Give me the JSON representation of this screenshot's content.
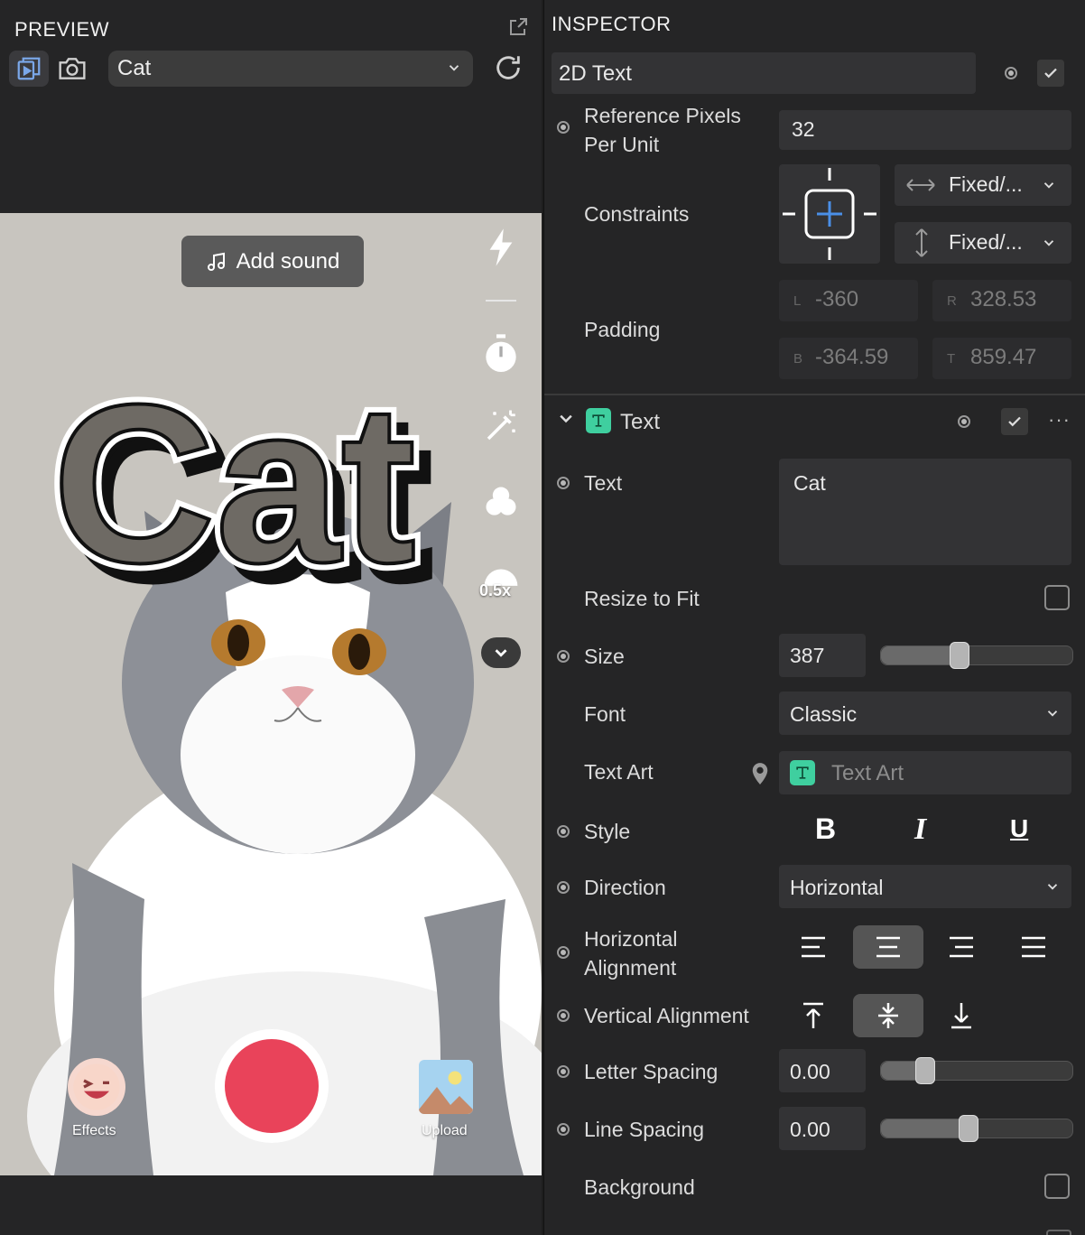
{
  "preview": {
    "title": "PREVIEW",
    "selector_value": "Cat",
    "add_sound": "Add sound",
    "zoom": "0.5x",
    "effects_label": "Effects",
    "upload_label": "Upload",
    "record_color": "#e9435a"
  },
  "inspector": {
    "title": "INSPECTOR",
    "object_name": "2D Text",
    "ref_pixels": {
      "label_line1": "Reference Pixels",
      "label_line2": "Per Unit",
      "value": "32"
    },
    "constraints": {
      "label": "Constraints",
      "horizontal": "Fixed/...",
      "vertical": "Fixed/..."
    },
    "padding": {
      "label": "Padding",
      "l_key": "L",
      "l": "-360",
      "r_key": "R",
      "r": "328.53",
      "b_key": "B",
      "b": "-364.59",
      "t_key": "T",
      "t": "859.47"
    },
    "text_section": {
      "title": "Text",
      "text_label": "Text",
      "text_value": "Cat",
      "resize_label": "Resize to Fit",
      "size_label": "Size",
      "size_value": "387",
      "size_fraction": 0.4,
      "font_label": "Font",
      "font_value": "Classic",
      "textart_label": "Text Art",
      "textart_value": "Text Art",
      "style_label": "Style",
      "bold": "B",
      "italic": "I",
      "underline": "U",
      "direction_label": "Direction",
      "direction_value": "Horizontal",
      "halign_label_1": "Horizontal",
      "halign_label_2": "Alignment",
      "valign_label": "Vertical Alignment",
      "letter_label": "Letter Spacing",
      "letter_value": "0.00",
      "letter_fraction": 0.2,
      "line_label": "Line Spacing",
      "line_value": "0.00",
      "line_fraction": 0.45,
      "background_label": "Background"
    }
  },
  "canvas_text": "Cat"
}
